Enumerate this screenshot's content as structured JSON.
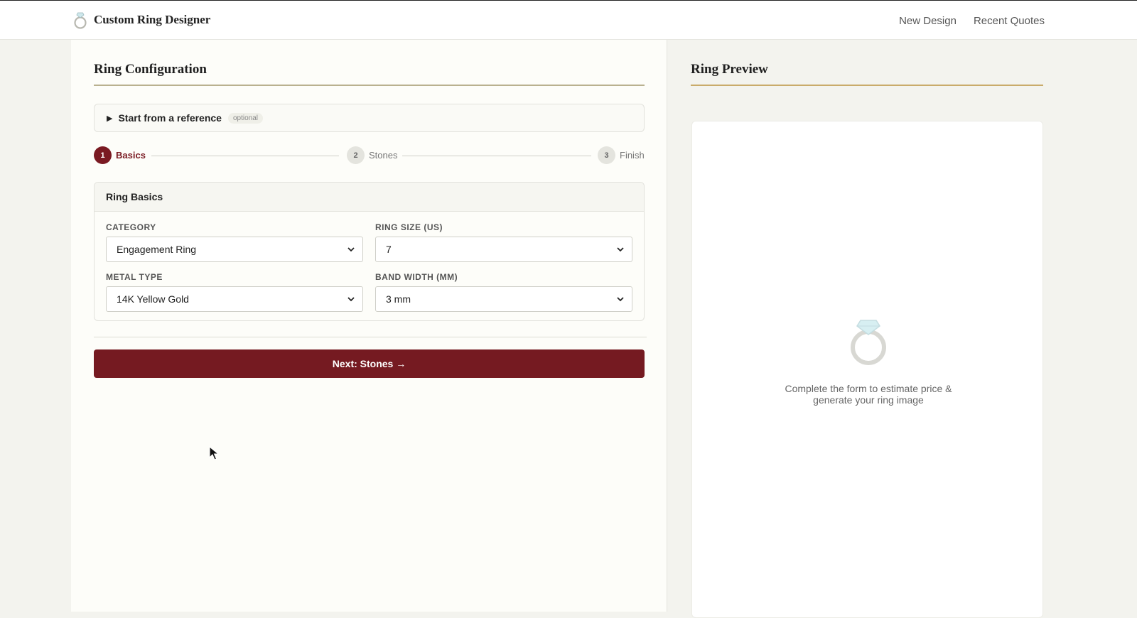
{
  "header": {
    "brand_icon": "ring-icon",
    "title": "Custom Ring Designer",
    "nav": [
      {
        "label": "New Design"
      },
      {
        "label": "Recent Quotes"
      }
    ]
  },
  "config": {
    "title": "Ring Configuration",
    "reference": {
      "label": "Start from a reference",
      "badge": "optional"
    },
    "steps": [
      {
        "number": "1",
        "label": "Basics",
        "active": true
      },
      {
        "number": "2",
        "label": "Stones",
        "active": false
      },
      {
        "number": "3",
        "label": "Finish",
        "active": false
      }
    ],
    "basics": {
      "title": "Ring Basics",
      "fields": [
        {
          "label": "CATEGORY",
          "value": "Engagement Ring"
        },
        {
          "label": "RING SIZE (US)",
          "value": "7"
        },
        {
          "label": "METAL TYPE",
          "value": "14K Yellow Gold"
        },
        {
          "label": "BAND WIDTH (MM)",
          "value": "3 mm"
        }
      ]
    },
    "next_button": "Next: Stones →"
  },
  "preview": {
    "title": "Ring Preview",
    "icon": "ring-icon",
    "message": "Complete the form to estimate price & generate your ring image"
  },
  "colors": {
    "accent": "#751a21",
    "gold_rule": "#c9ab6a"
  }
}
